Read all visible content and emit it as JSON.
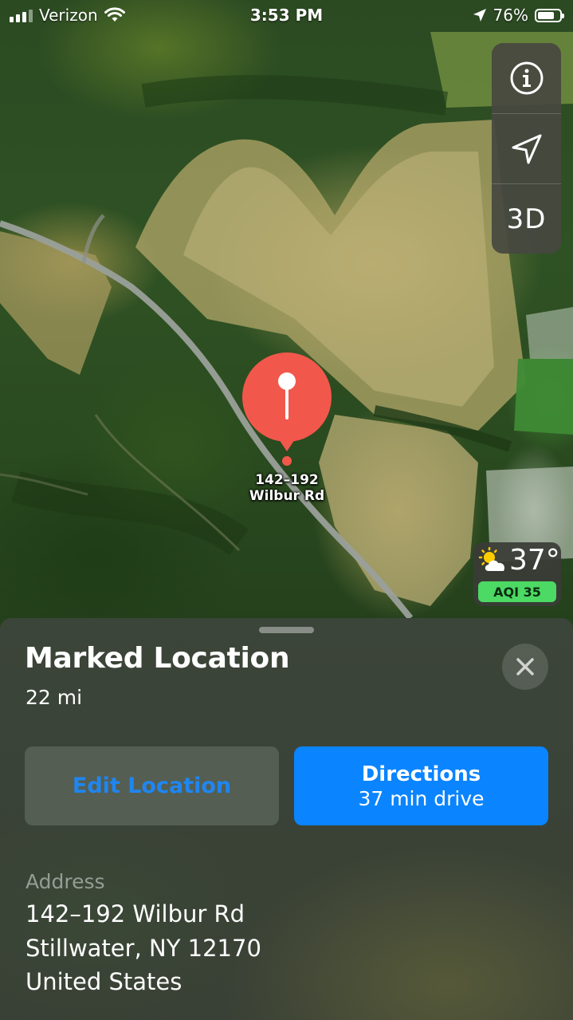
{
  "status_bar": {
    "carrier": "Verizon",
    "time": "3:53 PM",
    "battery_text": "76%",
    "battery_level": 0.76
  },
  "map_controls": {
    "info_icon": "info-icon",
    "location_icon": "location-arrow-icon",
    "three_d_label": "3D"
  },
  "pin": {
    "label_line1": "142–192",
    "label_line2": "Wilbur Rd",
    "color": "#f2574c"
  },
  "weather": {
    "icon": "partly-cloudy-icon",
    "temperature": "37°",
    "aqi": "AQI 35",
    "aqi_color": "#4cd964"
  },
  "sheet": {
    "title": "Marked Location",
    "distance": "22 mi",
    "edit_button": "Edit Location",
    "directions_button": "Directions",
    "directions_time": "37 min drive",
    "address_label": "Address",
    "address_lines": [
      "142–192 Wilbur Rd",
      "Stillwater, NY  12170",
      "United States"
    ]
  },
  "colors": {
    "accent": "#0a84ff",
    "edit_text": "#1f86f0"
  }
}
